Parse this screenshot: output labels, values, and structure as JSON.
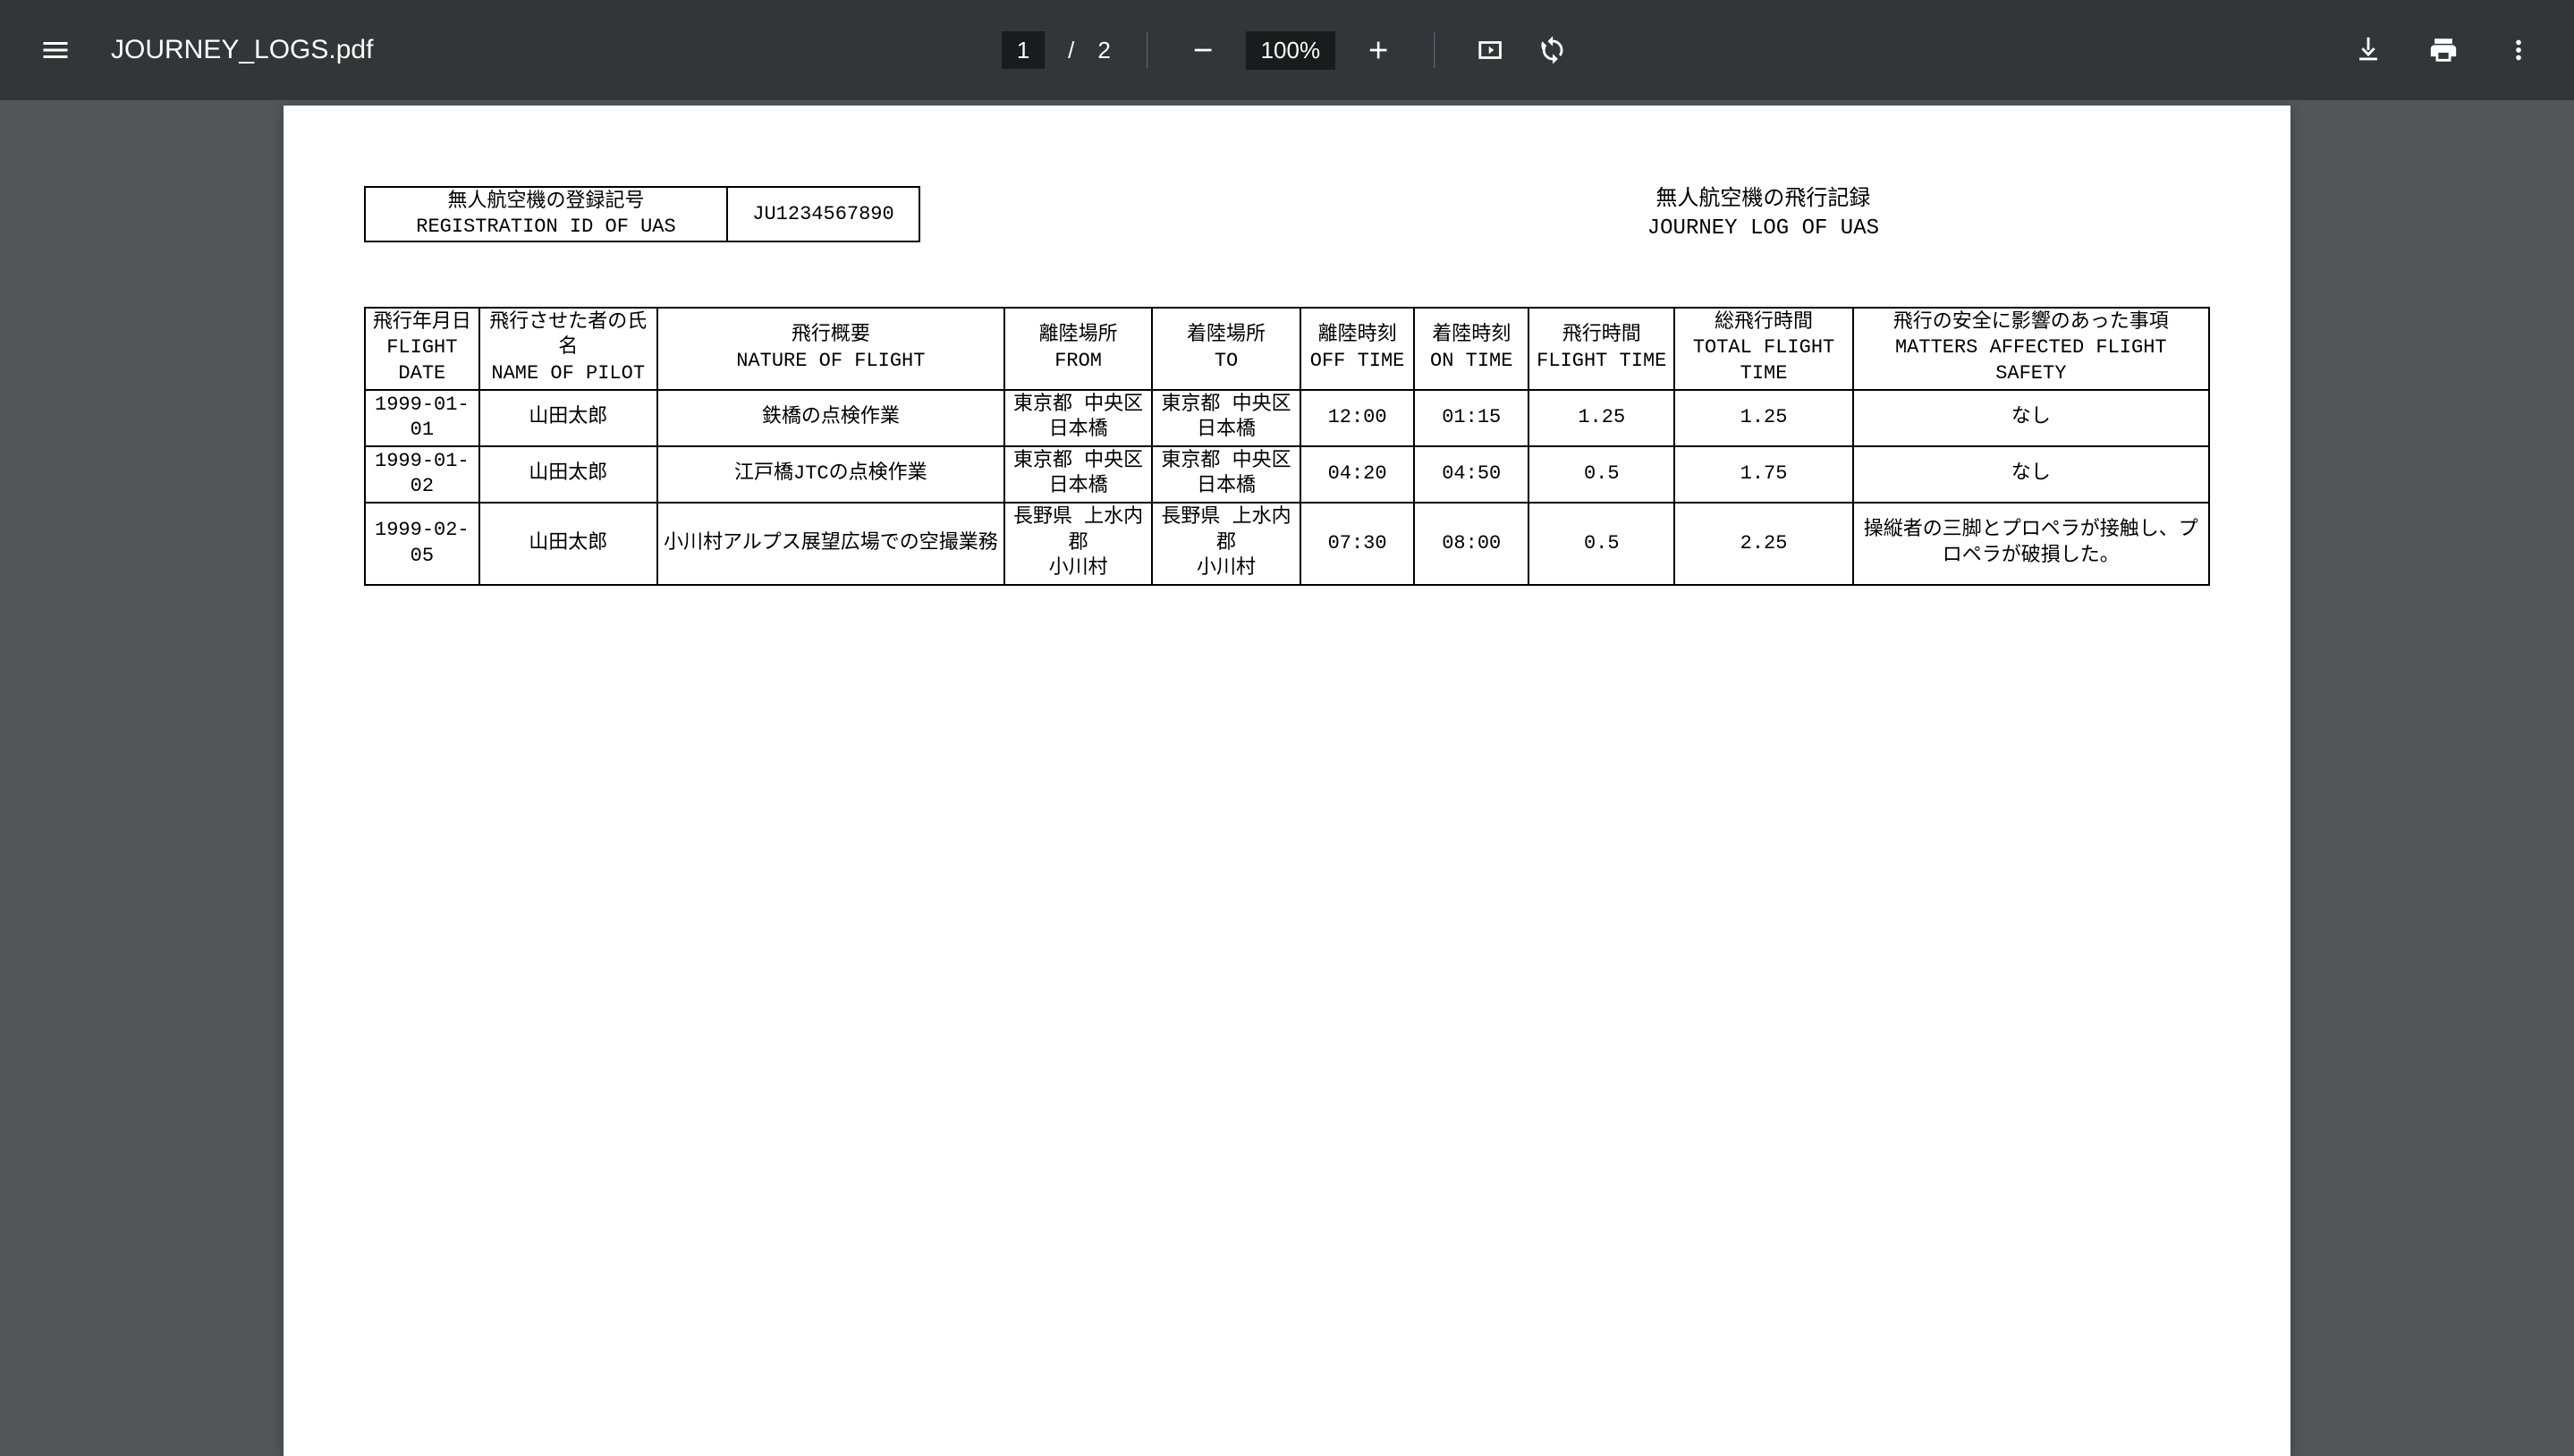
{
  "toolbar": {
    "filename": "JOURNEY_LOGS.pdf",
    "current_page": "1",
    "slash": "/",
    "total_pages": "2",
    "zoom": "100%"
  },
  "doc": {
    "reg_label_ja": "無人航空機の登録記号",
    "reg_label_en": "REGISTRATION ID OF UAS",
    "reg_value": "JU1234567890",
    "title_ja": "無人航空機の飛行記録",
    "title_en": "JOURNEY LOG OF UAS",
    "headers": {
      "date": "飛行年月日\nFLIGHT DATE",
      "pilot": "飛行させた者の氏名\nNAME OF PILOT",
      "nature": "飛行概要\nNATURE OF FLIGHT",
      "from": "離陸場所\nFROM",
      "to": "着陸場所\nTO",
      "off": "離陸時刻\nOFF TIME",
      "on": "着陸時刻\nON TIME",
      "ft": "飛行時間\nFLIGHT TIME",
      "tft": "総飛行時間\nTOTAL FLIGHT TIME",
      "safety": "飛行の安全に影響のあった事項\nMATTERS AFFECTED FLIGHT SAFETY"
    },
    "rows": [
      {
        "date": "1999-01-01",
        "pilot": "山田太郎",
        "nature": "鉄橋の点検作業",
        "from": "東京都 中央区\n日本橋",
        "to": "東京都 中央区\n日本橋",
        "off": "12:00",
        "on": "01:15",
        "ft": "1.25",
        "tft": "1.25",
        "safety": "なし"
      },
      {
        "date": "1999-01-02",
        "pilot": "山田太郎",
        "nature": "江戸橋JTCの点検作業",
        "from": "東京都 中央区\n日本橋",
        "to": "東京都 中央区\n日本橋",
        "off": "04:20",
        "on": "04:50",
        "ft": "0.5",
        "tft": "1.75",
        "safety": "なし"
      },
      {
        "date": "1999-02-05",
        "pilot": "山田太郎",
        "nature": "小川村アルプス展望広場での空撮業務",
        "from": "長野県 上水内郡\n小川村",
        "to": "長野県 上水内郡\n小川村",
        "off": "07:30",
        "on": "08:00",
        "ft": "0.5",
        "tft": "2.25",
        "safety": "操縦者の三脚とプロペラが接触し、プロペラが破損した。"
      }
    ]
  }
}
